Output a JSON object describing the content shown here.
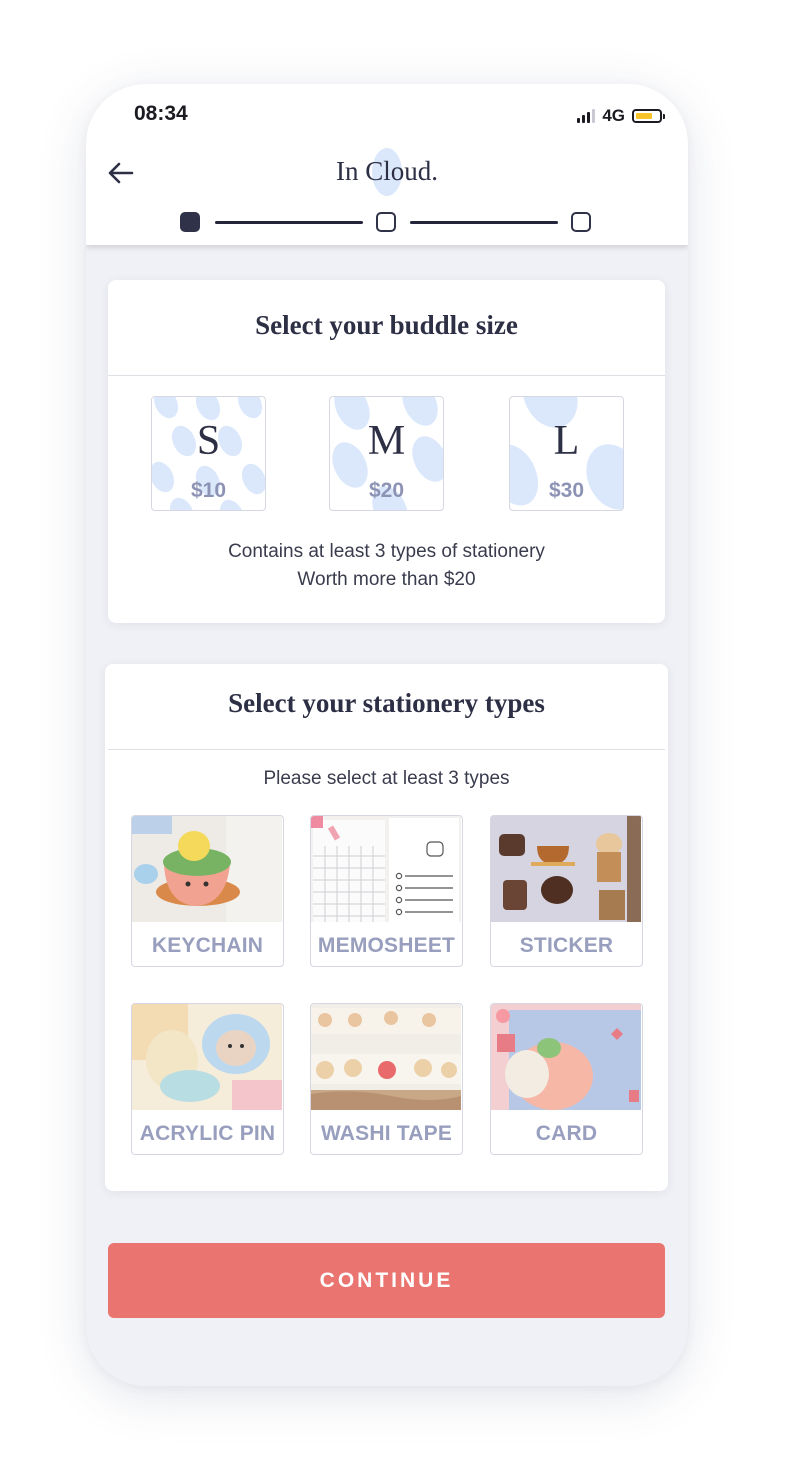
{
  "status_bar": {
    "time": "08:34",
    "network": "4G"
  },
  "header": {
    "brand": "In Cloud.",
    "steps": [
      "active",
      "inactive",
      "inactive"
    ]
  },
  "size_section": {
    "title": "Select your buddle size",
    "options": [
      {
        "letter": "S",
        "price": "$10"
      },
      {
        "letter": "M",
        "price": "$20"
      },
      {
        "letter": "L",
        "price": "$30"
      }
    ],
    "desc_line1": "Contains at least 3 types of stationery",
    "desc_line2": "Worth more than $20"
  },
  "types_section": {
    "title": "Select your stationery types",
    "hint": "Please select at least 3 types",
    "items": [
      {
        "label": "KEYCHAIN"
      },
      {
        "label": "MEMOSHEET"
      },
      {
        "label": "STICKER"
      },
      {
        "label": "ACRYLIC PIN"
      },
      {
        "label": "WASHI TAPE"
      },
      {
        "label": "CARD"
      }
    ]
  },
  "continue_label": "CONTINUE",
  "colors": {
    "accent": "#ea7470",
    "navy": "#2d2f45",
    "muted_label": "#989ebd",
    "pattern_blue": "#dbe8fc"
  }
}
